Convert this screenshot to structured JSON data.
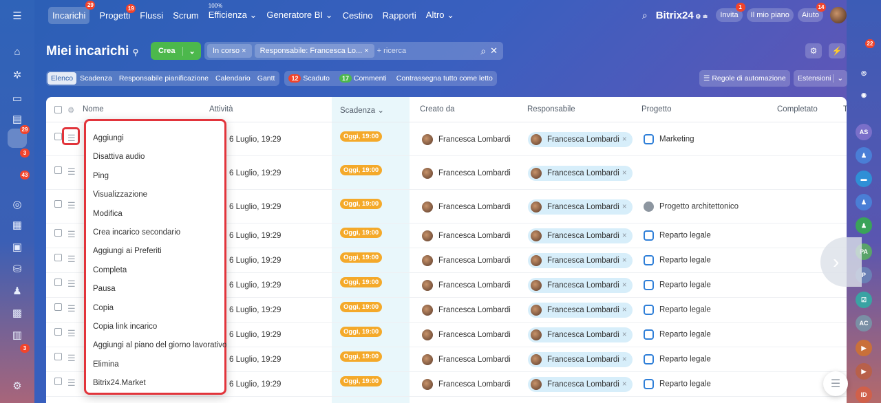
{
  "topnav": {
    "items": [
      {
        "label": "Incarichi",
        "count": "29",
        "active": true
      },
      {
        "label": "Progetti",
        "count": "19"
      },
      {
        "label": "Flussi"
      },
      {
        "label": "Scrum"
      },
      {
        "label": "Efficienza ⌄",
        "sup": "100%"
      },
      {
        "label": "Generatore BI ⌄"
      },
      {
        "label": "Cestino"
      },
      {
        "label": "Rapporti"
      },
      {
        "label": "Altro ⌄"
      }
    ],
    "brand": "Bitrix24",
    "invite": "Invita",
    "invite_count": "1",
    "plan": "Il mio piano",
    "help": "Aiuto",
    "help_count": "14"
  },
  "page": {
    "title": "Miei incarichi",
    "create": "Crea",
    "filters": [
      "In corso ×",
      "Responsabile: Francesca Lo... ×"
    ],
    "search_placeholder": "+ ricerca",
    "automation": "Regole di automazione",
    "extensions": "Estensioni"
  },
  "views": [
    "Elenco",
    "Scadenza",
    "Responsabile pianificazione",
    "Calendario",
    "Gantt"
  ],
  "counters": {
    "overdue_n": "12",
    "overdue": "Scaduto",
    "comments_n": "17",
    "comments": "Commenti",
    "mark_read": "Contrassegna tutto come letto"
  },
  "columns": [
    "Nome",
    "Attività",
    "Scadenza ⌄",
    "Creato da",
    "Responsabile",
    "Progetto",
    "Completato",
    "T"
  ],
  "rows": [
    {
      "activity": "6 Luglio, 19:29",
      "due": "Oggi, 19:00",
      "creator": "Francesca Lombardi",
      "resp": "Francesca Lombardi",
      "project": "Marketing",
      "ptype": "folder"
    },
    {
      "activity": "6 Luglio, 19:29",
      "due": "Oggi, 19:00",
      "creator": "Francesca Lombardi",
      "resp": "Francesca Lombardi",
      "project": "",
      "ptype": ""
    },
    {
      "activity": "6 Luglio, 19:29",
      "due": "Oggi, 19:00",
      "creator": "Francesca Lombardi",
      "resp": "Francesca Lombardi",
      "project": "Progetto architettonico",
      "ptype": "group"
    },
    {
      "activity": "6 Luglio, 19:29",
      "due": "Oggi, 19:00",
      "creator": "Francesca Lombardi",
      "resp": "Francesca Lombardi",
      "project": "Reparto legale",
      "ptype": "folder"
    },
    {
      "activity": "6 Luglio, 19:29",
      "due": "Oggi, 19:00",
      "creator": "Francesca Lombardi",
      "resp": "Francesca Lombardi",
      "project": "Reparto legale",
      "ptype": "folder"
    },
    {
      "activity": "6 Luglio, 19:29",
      "due": "Oggi, 19:00",
      "creator": "Francesca Lombardi",
      "resp": "Francesca Lombardi",
      "project": "Reparto legale",
      "ptype": "folder"
    },
    {
      "activity": "6 Luglio, 19:29",
      "due": "Oggi, 19:00",
      "creator": "Francesca Lombardi",
      "resp": "Francesca Lombardi",
      "project": "Reparto legale",
      "ptype": "folder"
    },
    {
      "activity": "6 Luglio, 19:29",
      "due": "Oggi, 19:00",
      "creator": "Francesca Lombardi",
      "resp": "Francesca Lombardi",
      "project": "Reparto legale",
      "ptype": "folder"
    },
    {
      "activity": "6 Luglio, 19:29",
      "due": "Oggi, 19:00",
      "creator": "Francesca Lombardi",
      "resp": "Francesca Lombardi",
      "project": "Reparto legale",
      "ptype": "folder"
    },
    {
      "activity": "6 Luglio, 19:29",
      "due": "Oggi, 19:00",
      "creator": "Francesca Lombardi",
      "resp": "Francesca Lombardi",
      "project": "Reparto legale",
      "ptype": "folder"
    }
  ],
  "menu": [
    "Aggiungi",
    "Disattiva audio",
    "Ping",
    "Visualizzazione",
    "Modifica",
    "Crea incarico secondario",
    "Aggiungi ai Preferiti",
    "Completa",
    "Pausa",
    "Copia",
    "Copia link incarico",
    "Aggiungi al piano del giorno lavorativo",
    "Elimina",
    "Bitrix24.Market"
  ],
  "leftbar": [
    {
      "icon": "home-icon",
      "glyph": "⌂"
    },
    {
      "icon": "activity-icon",
      "glyph": "✲"
    },
    {
      "icon": "chat-icon",
      "glyph": "▭"
    },
    {
      "icon": "feed-icon",
      "glyph": "▤"
    },
    {
      "icon": "tasks-icon",
      "glyph": "✔",
      "count": "29",
      "active": true
    },
    {
      "icon": "mail-icon",
      "glyph": "✉",
      "count": "3"
    },
    {
      "icon": "funnel-icon",
      "glyph": "☰",
      "count": "43"
    },
    {
      "icon": "target-icon",
      "glyph": "◎"
    },
    {
      "icon": "calendar-icon",
      "glyph": "▦"
    },
    {
      "icon": "docs-icon",
      "glyph": "▣"
    },
    {
      "icon": "drive-icon",
      "glyph": "⛁"
    },
    {
      "icon": "people-icon",
      "glyph": "♟"
    },
    {
      "icon": "screen-icon",
      "glyph": "▩"
    },
    {
      "icon": "schedule-icon",
      "glyph": "▥"
    },
    {
      "icon": "sign-icon",
      "glyph": "✎",
      "count": "3"
    },
    {
      "icon": "settings-icon",
      "glyph": "⚙"
    }
  ],
  "rightbar": [
    {
      "icon": "bell-icon",
      "label": "🔔",
      "count": "22",
      "color": "transparent"
    },
    {
      "icon": "copilot-icon",
      "label": "◎",
      "color": "transparent"
    },
    {
      "icon": "support-icon",
      "label": "◉",
      "color": "transparent"
    },
    {
      "icon": "avatar-as",
      "label": "AS",
      "color": "#7a6fc9"
    },
    {
      "icon": "group-icon",
      "label": "♟",
      "color": "#4a7ed6"
    },
    {
      "icon": "chat-bubble-icon",
      "label": "▬",
      "color": "#2f8fd6"
    },
    {
      "icon": "group-icon",
      "label": "♟",
      "color": "#4a7ed6"
    },
    {
      "icon": "group-icon",
      "label": "♟",
      "color": "#3aa35a"
    },
    {
      "icon": "avatar-pa",
      "label": "PA",
      "color": "#5aa36a"
    },
    {
      "icon": "avatar-p",
      "label": "P",
      "color": "#6a7fb5"
    },
    {
      "icon": "check-icon",
      "label": "☑",
      "color": "#3aa3a3"
    },
    {
      "icon": "avatar-ac",
      "label": "AC",
      "color": "#7a8fa5"
    },
    {
      "icon": "video-icon",
      "label": "▶",
      "color": "#c9703a"
    },
    {
      "icon": "video-icon",
      "label": "▶",
      "color": "#b8604a"
    },
    {
      "icon": "avatar-id",
      "label": "ID",
      "color": "#d0604a"
    }
  ]
}
